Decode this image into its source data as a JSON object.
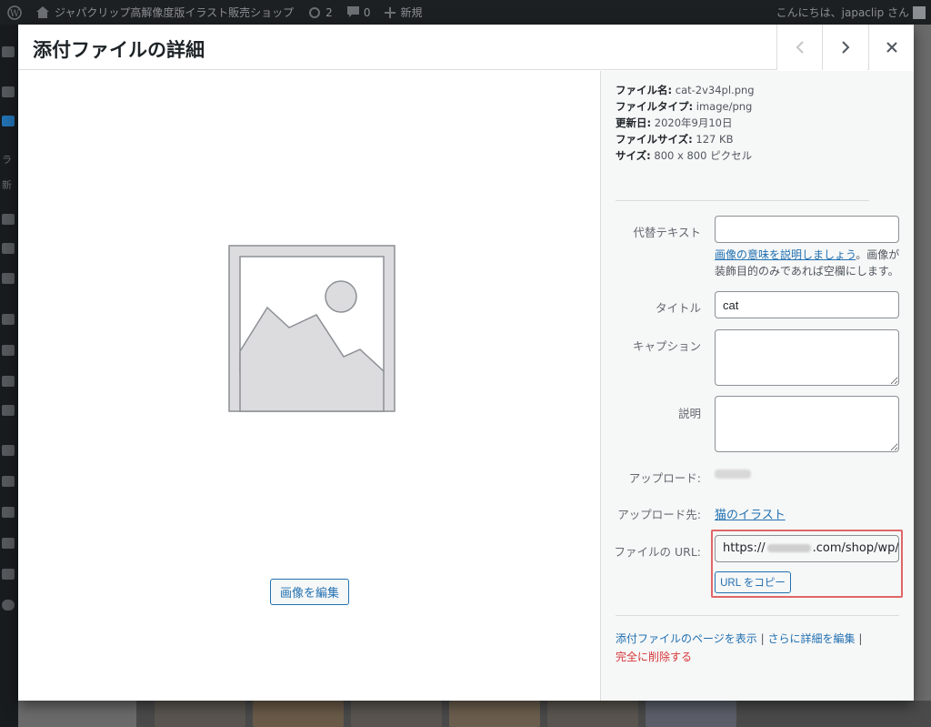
{
  "adminbar": {
    "site_name": "ジャパクリップ高解像度版イラスト販売ショップ",
    "updates_count": "2",
    "comments_count": "0",
    "new_label": "新規",
    "greeting": "こんにちは、japaclip さん"
  },
  "adminmenu": {
    "label_library": "ラ",
    "label_new": "新"
  },
  "modal": {
    "title": "添付ファイルの詳細",
    "prev_label": "前のメディア項目を編集",
    "next_label": "次のメディア項目を編集",
    "close_label": "閉じる",
    "edit_image_label": "画像を編集"
  },
  "details": {
    "filename_label": "ファイル名:",
    "filename": "cat-2v34pl.png",
    "filetype_label": "ファイルタイプ:",
    "filetype": "image/png",
    "uploaded_label": "更新日:",
    "uploaded": "2020年9月10日",
    "filesize_label": "ファイルサイズ:",
    "filesize": "127 KB",
    "dimensions_label": "サイズ:",
    "dimensions": "800 x 800 ピクセル"
  },
  "fields": {
    "alt_label": "代替テキスト",
    "alt_value": "",
    "alt_hint_link": "画像の意味を説明しましょう",
    "alt_hint_text": "。画像が装飾目的のみであれば空欄にします。",
    "title_label": "タイトル",
    "title_value": "cat",
    "caption_label": "キャプション",
    "caption_value": "",
    "description_label": "説明",
    "description_value": "",
    "uploader_label": "アップロード:",
    "uploaded_to_label": "アップロード先:",
    "uploaded_to_link": "猫のイラスト",
    "url_label": "ファイルの URL:",
    "url_prefix": "https://",
    "url_suffix": ".com/shop/wp/",
    "copy_url_label": "URL をコピー"
  },
  "actions": {
    "view_page": "添付ファイルのページを表示",
    "separator": "|",
    "edit_more": "さらに詳細を編集",
    "delete": "完全に削除する"
  }
}
